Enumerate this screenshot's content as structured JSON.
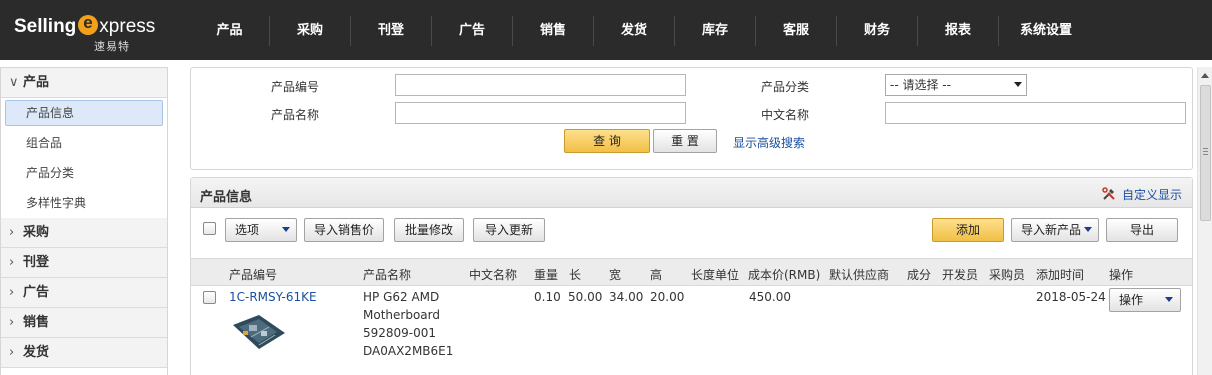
{
  "brand": {
    "name_left": "Selling",
    "name_e": "e",
    "name_right": "xpress",
    "sub": "速易特"
  },
  "nav": [
    "产品",
    "采购",
    "刊登",
    "广告",
    "销售",
    "发货",
    "库存",
    "客服",
    "财务",
    "报表",
    "系统设置"
  ],
  "sidebar": {
    "group_product": "产品",
    "items": [
      "产品信息",
      "组合品",
      "产品分类",
      "多样性字典"
    ],
    "groups": [
      "采购",
      "刊登",
      "广告",
      "销售",
      "发货"
    ]
  },
  "search": {
    "label_product_no": "产品编号",
    "label_product_name": "产品名称",
    "label_category": "产品分类",
    "label_cn_name": "中文名称",
    "category_selected": "-- 请选择 --",
    "btn_query": "查 询",
    "btn_reset": "重 置",
    "advanced_link": "显示高级搜索"
  },
  "panel": {
    "title": "产品信息",
    "custom_display": "自定义显示",
    "toolbar": {
      "options": "选项",
      "import_price": "导入销售价",
      "batch_edit": "批量修改",
      "import_update": "导入更新",
      "add": "添加",
      "import_new": "导入新产品",
      "export": "导出"
    },
    "columns": [
      "产品编号",
      "产品名称",
      "中文名称",
      "重量",
      "长",
      "宽",
      "高",
      "长度单位",
      "成本价(RMB)",
      "默认供应商",
      "成分",
      "开发员",
      "采购员",
      "添加时间",
      "操作"
    ],
    "rows": [
      {
        "sku": "1C-RMSY-61KE",
        "name_lines": [
          "HP G62 AMD",
          "Motherboard",
          "592809-001",
          "DA0AX2MB6E1"
        ],
        "weight": "0.10",
        "length": "50.00",
        "width": "34.00",
        "height": "20.00",
        "cost": "450.00",
        "added": "2018-05-24",
        "action": "操作"
      }
    ]
  },
  "colors": {
    "topbar": "#2b2b2b",
    "accent_orange": "#f3a11c",
    "link": "#1a4fa0",
    "btn_yellow": "#f2bf46"
  }
}
